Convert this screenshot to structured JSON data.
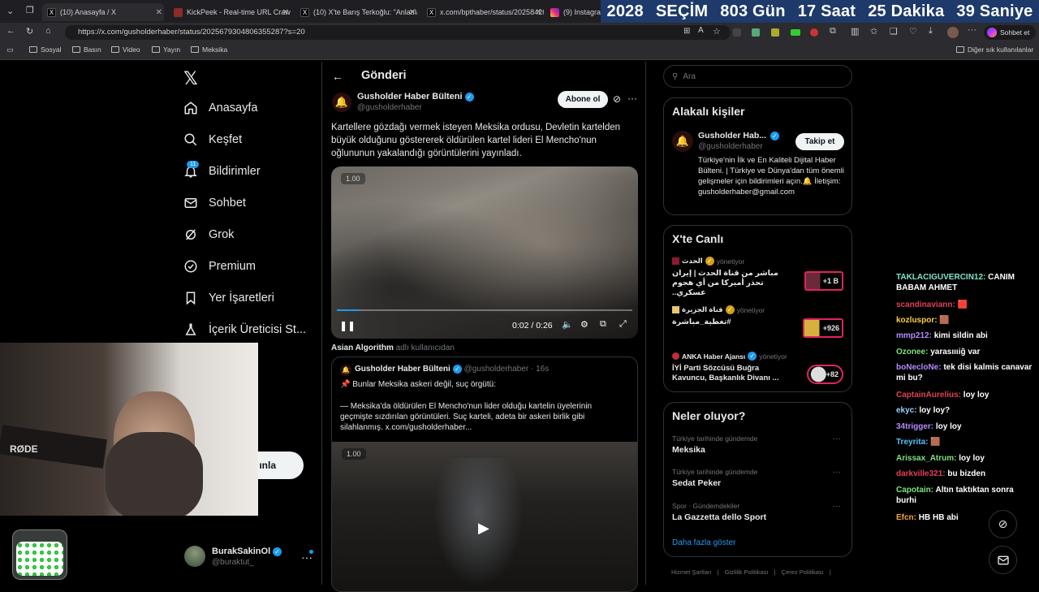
{
  "tabs": [
    {
      "label": "(10) Anasayfa / X"
    },
    {
      "label": "KickPeek - Real-time URL Crawler"
    },
    {
      "label": "(10) X'te Barış Terkoğlu: \"Anlatılan\""
    },
    {
      "label": "x.com/bpthaber/status/20258426"
    },
    {
      "label": "(9) Instagram"
    }
  ],
  "countdown": {
    "year": "2028",
    "word": "SEÇİM",
    "days": "803 Gün",
    "hours": "17 Saat",
    "minutes": "25 Dakika",
    "seconds": "39 Saniye"
  },
  "address": {
    "url": "https://x.com/gusholderhaber/status/2025679304806355287?s=20",
    "chat_button": "Sohbet et"
  },
  "bookmarks": [
    {
      "label": "Sosyal"
    },
    {
      "label": "Basın"
    },
    {
      "label": "Video"
    },
    {
      "label": "Yayın"
    },
    {
      "label": "Meksika"
    }
  ],
  "bookmarks_other": "Diğer sık kullanılanlar",
  "nav": {
    "items": [
      {
        "label": "Anasayfa"
      },
      {
        "label": "Keşfet"
      },
      {
        "label": "Bildirimler",
        "badge": "11"
      },
      {
        "label": "Sohbet"
      },
      {
        "label": "Grok"
      },
      {
        "label": "Premium"
      },
      {
        "label": "Yer İşaretleri"
      },
      {
        "label": "İçerik Üreticisi St..."
      }
    ],
    "post_button_partial": "ınla",
    "user": {
      "name": "BurakSakinOl",
      "handle": "@buraktut_"
    }
  },
  "post": {
    "header_title": "Gönderi",
    "author": "Gusholder Haber Bülteni",
    "handle": "@gusholderhaber",
    "subscribe": "Abone ol",
    "text": "Kartellere gözdağı vermek isteyen Meksika ordusu, Devletin kartelden büyük olduğunu göstererek öldürülen kartel lideri El Mencho'nun oğlununun yakalandığı görüntülerini yayınladı.",
    "video": {
      "speed": "1.00",
      "time": "0:02 / 0:26",
      "progress": 0.077
    },
    "from_user": "Asian Algorithm",
    "from_suffix": "adlı kullanıcıdan",
    "quote": {
      "author": "Gusholder Haber Bülteni",
      "handle_time": "@gusholderhaber · 16s",
      "line1": "📌 Bunlar Meksika askeri değil, suç örgütü:",
      "line2": "— Meksika'da öldürülen El Mencho'nun lider olduğu kartelin üyelerinin geçmişte sızdırılan görüntüleri. Suç karteli, adeta bir askeri birlik gibi silahlanmış.  x.com/gusholderhaber...",
      "speed": "1.00"
    }
  },
  "search": {
    "placeholder": "Ara"
  },
  "related": {
    "title": "Alakalı kişiler",
    "name": "Gusholder Hab...",
    "handle": "@gusholderhaber",
    "follow": "Takip et",
    "bio": "Türkiye'nin İlk ve En Kaliteli Dijital Haber Bülteni. | Türkiye ve Dünya'dan tüm önemli gelişmeler için bildirimleri açın.🔔 İletişim: gusholderhaber@gmail.com"
  },
  "live": {
    "title": "X'te Canlı",
    "items": [
      {
        "host": "الحدث",
        "role": "yönetiyor",
        "text": "مباشر من قناة الحدث | إيران تحذر أميركا من أي هجوم عسكري..",
        "count": "+1 B"
      },
      {
        "host": "قناة الجزيرة",
        "role": "yönetiyor",
        "text": "#تغطية_مباشرة",
        "count": "+926"
      },
      {
        "host": "ANKA Haber Ajansı",
        "role": "yönetiyor",
        "text": "İYİ Parti Sözcüsü Buğra Kavuncu, Başkanlık Divanı ...",
        "count": "+82"
      }
    ]
  },
  "trends": {
    "title": "Neler oluyor?",
    "items": [
      {
        "context": "Türkiye tarihinde gündemde",
        "name": "Meksika"
      },
      {
        "context": "Türkiye tarihinde gündemde",
        "name": "Sedat Peker"
      },
      {
        "context": "Spor · Gündemdekiler",
        "name": "La Gazzetta dello Sport"
      }
    ],
    "more": "Daha fazla göster"
  },
  "footer": {
    "terms": "Hizmet Şartları",
    "privacy": "Gizlilik Politikası",
    "cookies": "Çerez Politikası"
  },
  "webcam": {
    "brand": "RØDE"
  },
  "chat": [
    {
      "user": "TAKLACIGUVERCIN12:",
      "msg": "CANIM BABAM AHMET",
      "color": "#7fe3c9"
    },
    {
      "user": "scandinaviann:",
      "msg": "🟥",
      "color": "#e0405a"
    },
    {
      "user": "kozluspor:",
      "msg": "🟫",
      "color": "#f7d046"
    },
    {
      "user": "mmp212:",
      "msg": "kimi sildin abi",
      "color": "#b38aff"
    },
    {
      "user": "Ozonee:",
      "msg": "yarasıııiğ var",
      "color": "#7fe37f"
    },
    {
      "user": "boNecloNe:",
      "msg": "tek disi kalmis canavar mi bu?",
      "color": "#b38aff"
    },
    {
      "user": "CaptainAurelius:",
      "msg": "loy loy",
      "color": "#e0405a"
    },
    {
      "user": "ekyc:",
      "msg": "loy loy?",
      "color": "#9ad0ff"
    },
    {
      "user": "34trigger:",
      "msg": "loy loy",
      "color": "#b38aff"
    },
    {
      "user": "Treyrita:",
      "msg": "🟫",
      "color": "#4fc3f7"
    },
    {
      "user": "Arissax_Atrum:",
      "msg": "loy loy",
      "color": "#7fe37f"
    },
    {
      "user": "darkville321:",
      "msg": "bu bizden",
      "color": "#e0405a"
    },
    {
      "user": "Capotain:",
      "msg": "Altın taktıktan sonra burhi",
      "color": "#7fe37f"
    },
    {
      "user": "Efcn:",
      "msg": "HB HB abi",
      "color": "#f7a23a"
    }
  ],
  "colors": {
    "accent": "#1d9bf0",
    "bg": "#000000",
    "border": "#2f3336",
    "countdown_bg": "#1d3a6b"
  }
}
